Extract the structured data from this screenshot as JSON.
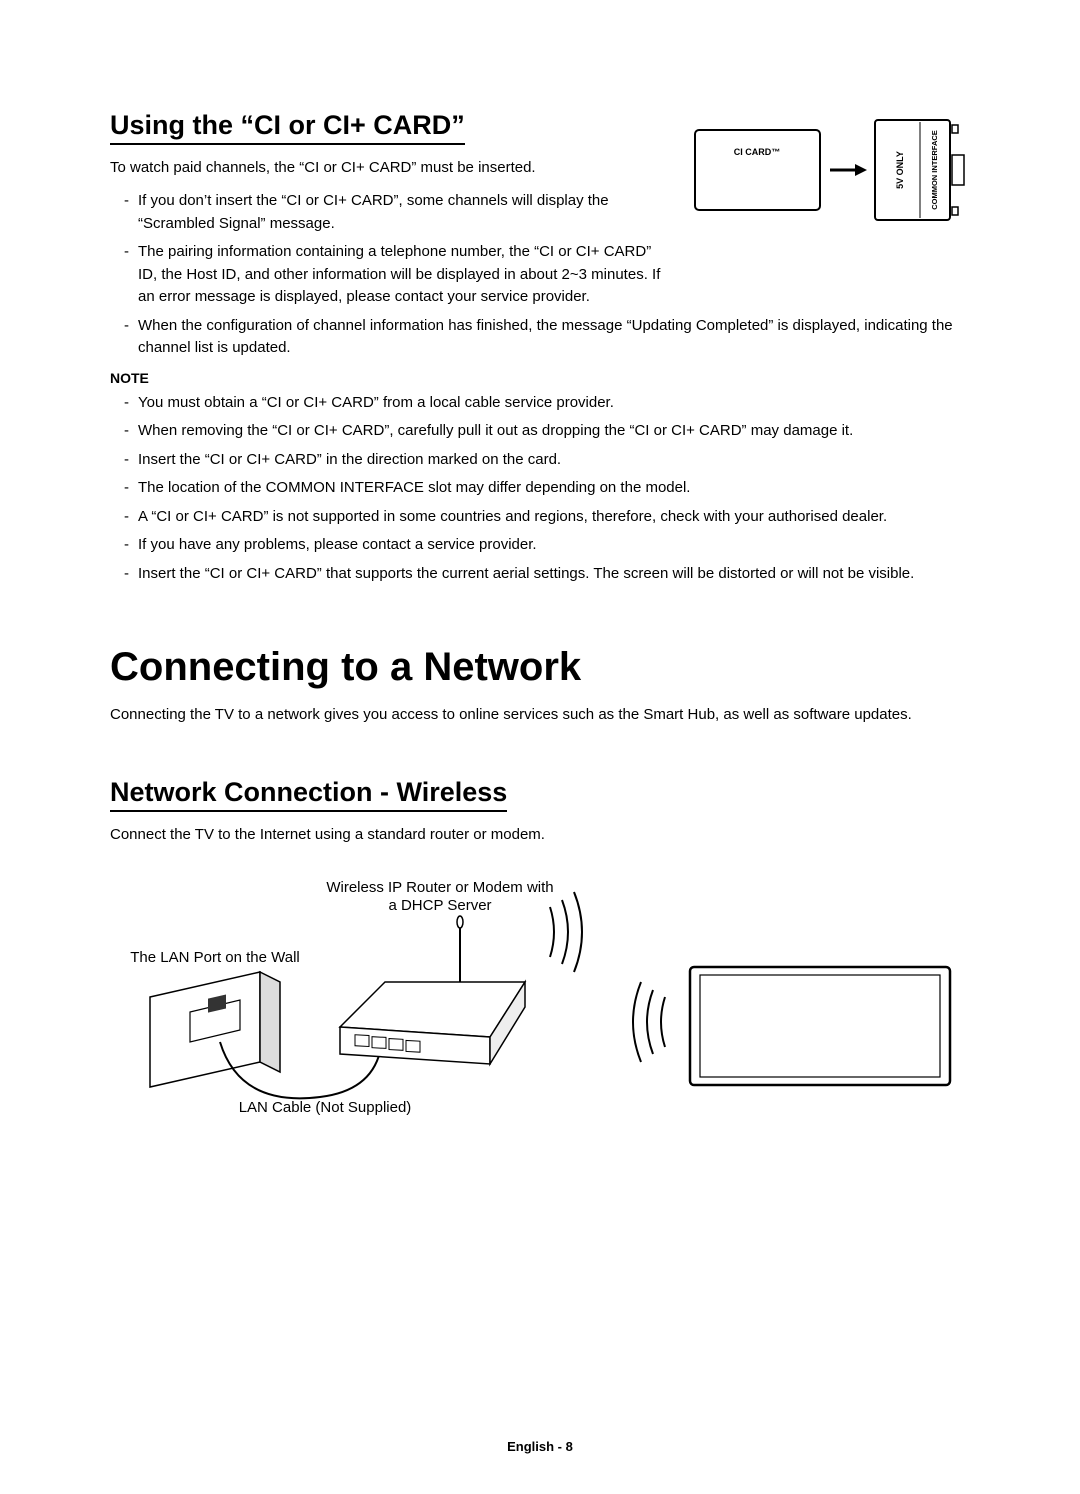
{
  "section1": {
    "title": "Using the “CI or CI+ CARD”",
    "intro": "To watch paid channels, the “CI or CI+ CARD” must be inserted.",
    "bullets": [
      "If you don’t insert the “CI or CI+ CARD”, some channels will display the “Scrambled Signal” message.",
      "The pairing information containing a telephone number, the “CI or CI+ CARD” ID, the Host ID, and other information will be displayed in about 2~3 minutes. If an error message is displayed, please contact your service provider.",
      "When the configuration of channel information has finished, the message “Updating Completed” is displayed, indicating the channel list is updated."
    ],
    "noteLabel": "NOTE",
    "notes": [
      "You must obtain a “CI or CI+ CARD” from a local cable service provider.",
      "When removing the “CI or CI+ CARD”, carefully pull it out as dropping the “CI or CI+ CARD” may damage it.",
      "Insert the “CI or CI+ CARD” in the direction marked on the card.",
      "The location of the COMMON INTERFACE slot may differ depending on the model.",
      "A “CI or CI+ CARD” is not supported in some countries and regions, therefore, check with your authorised dealer.",
      "If you have any problems, please contact a service provider.",
      "Insert the “CI or CI+ CARD” that supports the current aerial settings. The screen will be distorted or will not be visible."
    ],
    "diagram": {
      "cardLabel": "CI CARD™",
      "slotLabel1": "5V ONLY",
      "slotLabel2": "COMMON INTERFACE"
    }
  },
  "section2": {
    "heading": "Connecting to a Network",
    "intro": "Connecting the TV to a network gives you access to online services such as the Smart Hub, as well as software updates."
  },
  "section3": {
    "title": "Network Connection - Wireless",
    "intro": "Connect the TV to the Internet using a standard router or modem.",
    "labels": {
      "router": "Wireless IP Router or Modem with a DHCP Server",
      "wall": "The LAN Port on the Wall",
      "cable": "LAN Cable (Not Supplied)"
    }
  },
  "footer": "English - 8"
}
